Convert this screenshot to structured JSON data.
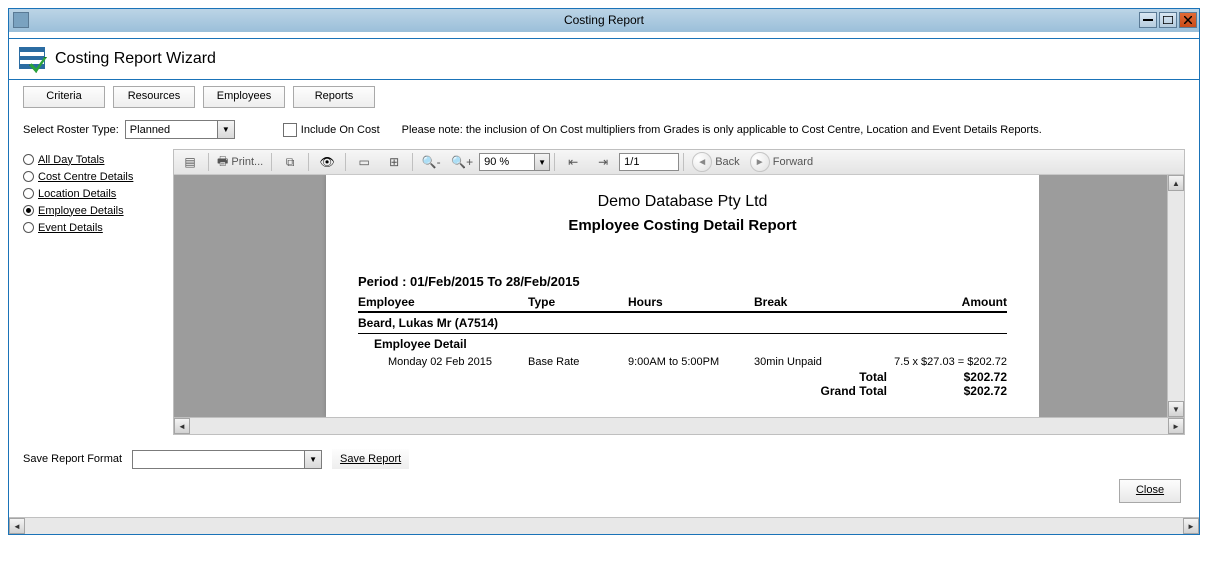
{
  "window": {
    "title": "Costing Report"
  },
  "wizard": {
    "title": "Costing Report Wizard"
  },
  "tabs": {
    "criteria": "Criteria",
    "resources": "Resources",
    "employees": "Employees",
    "reports": "Reports"
  },
  "options": {
    "roster_label": "Select Roster Type:",
    "roster_value": "Planned",
    "include_oncost_label": "Include On Cost",
    "note": "Please note: the inclusion of On Cost multipliers from Grades is only applicable to Cost Centre, Location and Event Details Reports."
  },
  "report_types": {
    "all_day_totals": "All Day Totals",
    "cost_centre_details": "Cost Centre Details",
    "location_details": "Location Details",
    "employee_details": "Employee Details",
    "event_details": "Event Details",
    "selected": "employee_details"
  },
  "toolbar": {
    "print": "Print...",
    "zoom_value": "90 %",
    "page_value": "1/1",
    "back": "Back",
    "forward": "Forward"
  },
  "report": {
    "company": "Demo Database Pty Ltd",
    "title": "Employee Costing Detail Report",
    "period_label": "Period :  01/Feb/2015 To 28/Feb/2015",
    "columns": {
      "employee": "Employee",
      "type": "Type",
      "hours": "Hours",
      "break": "Break",
      "amount": "Amount"
    },
    "employee_row": "Beard, Lukas Mr (A7514)",
    "subheader": "Employee Detail",
    "rows": [
      {
        "date": "Monday 02 Feb 2015",
        "type": "Base Rate",
        "hours": "9:00AM to 5:00PM",
        "break": "30min Unpaid",
        "amount": "7.5 x $27.03 = $202.72"
      }
    ],
    "total_label": "Total",
    "total_value": "$202.72",
    "grand_total_label": "Grand Total",
    "grand_total_value": "$202.72"
  },
  "footer": {
    "save_format_label": "Save Report Format",
    "save_report_btn": "Save Report",
    "close_btn": "Close"
  }
}
